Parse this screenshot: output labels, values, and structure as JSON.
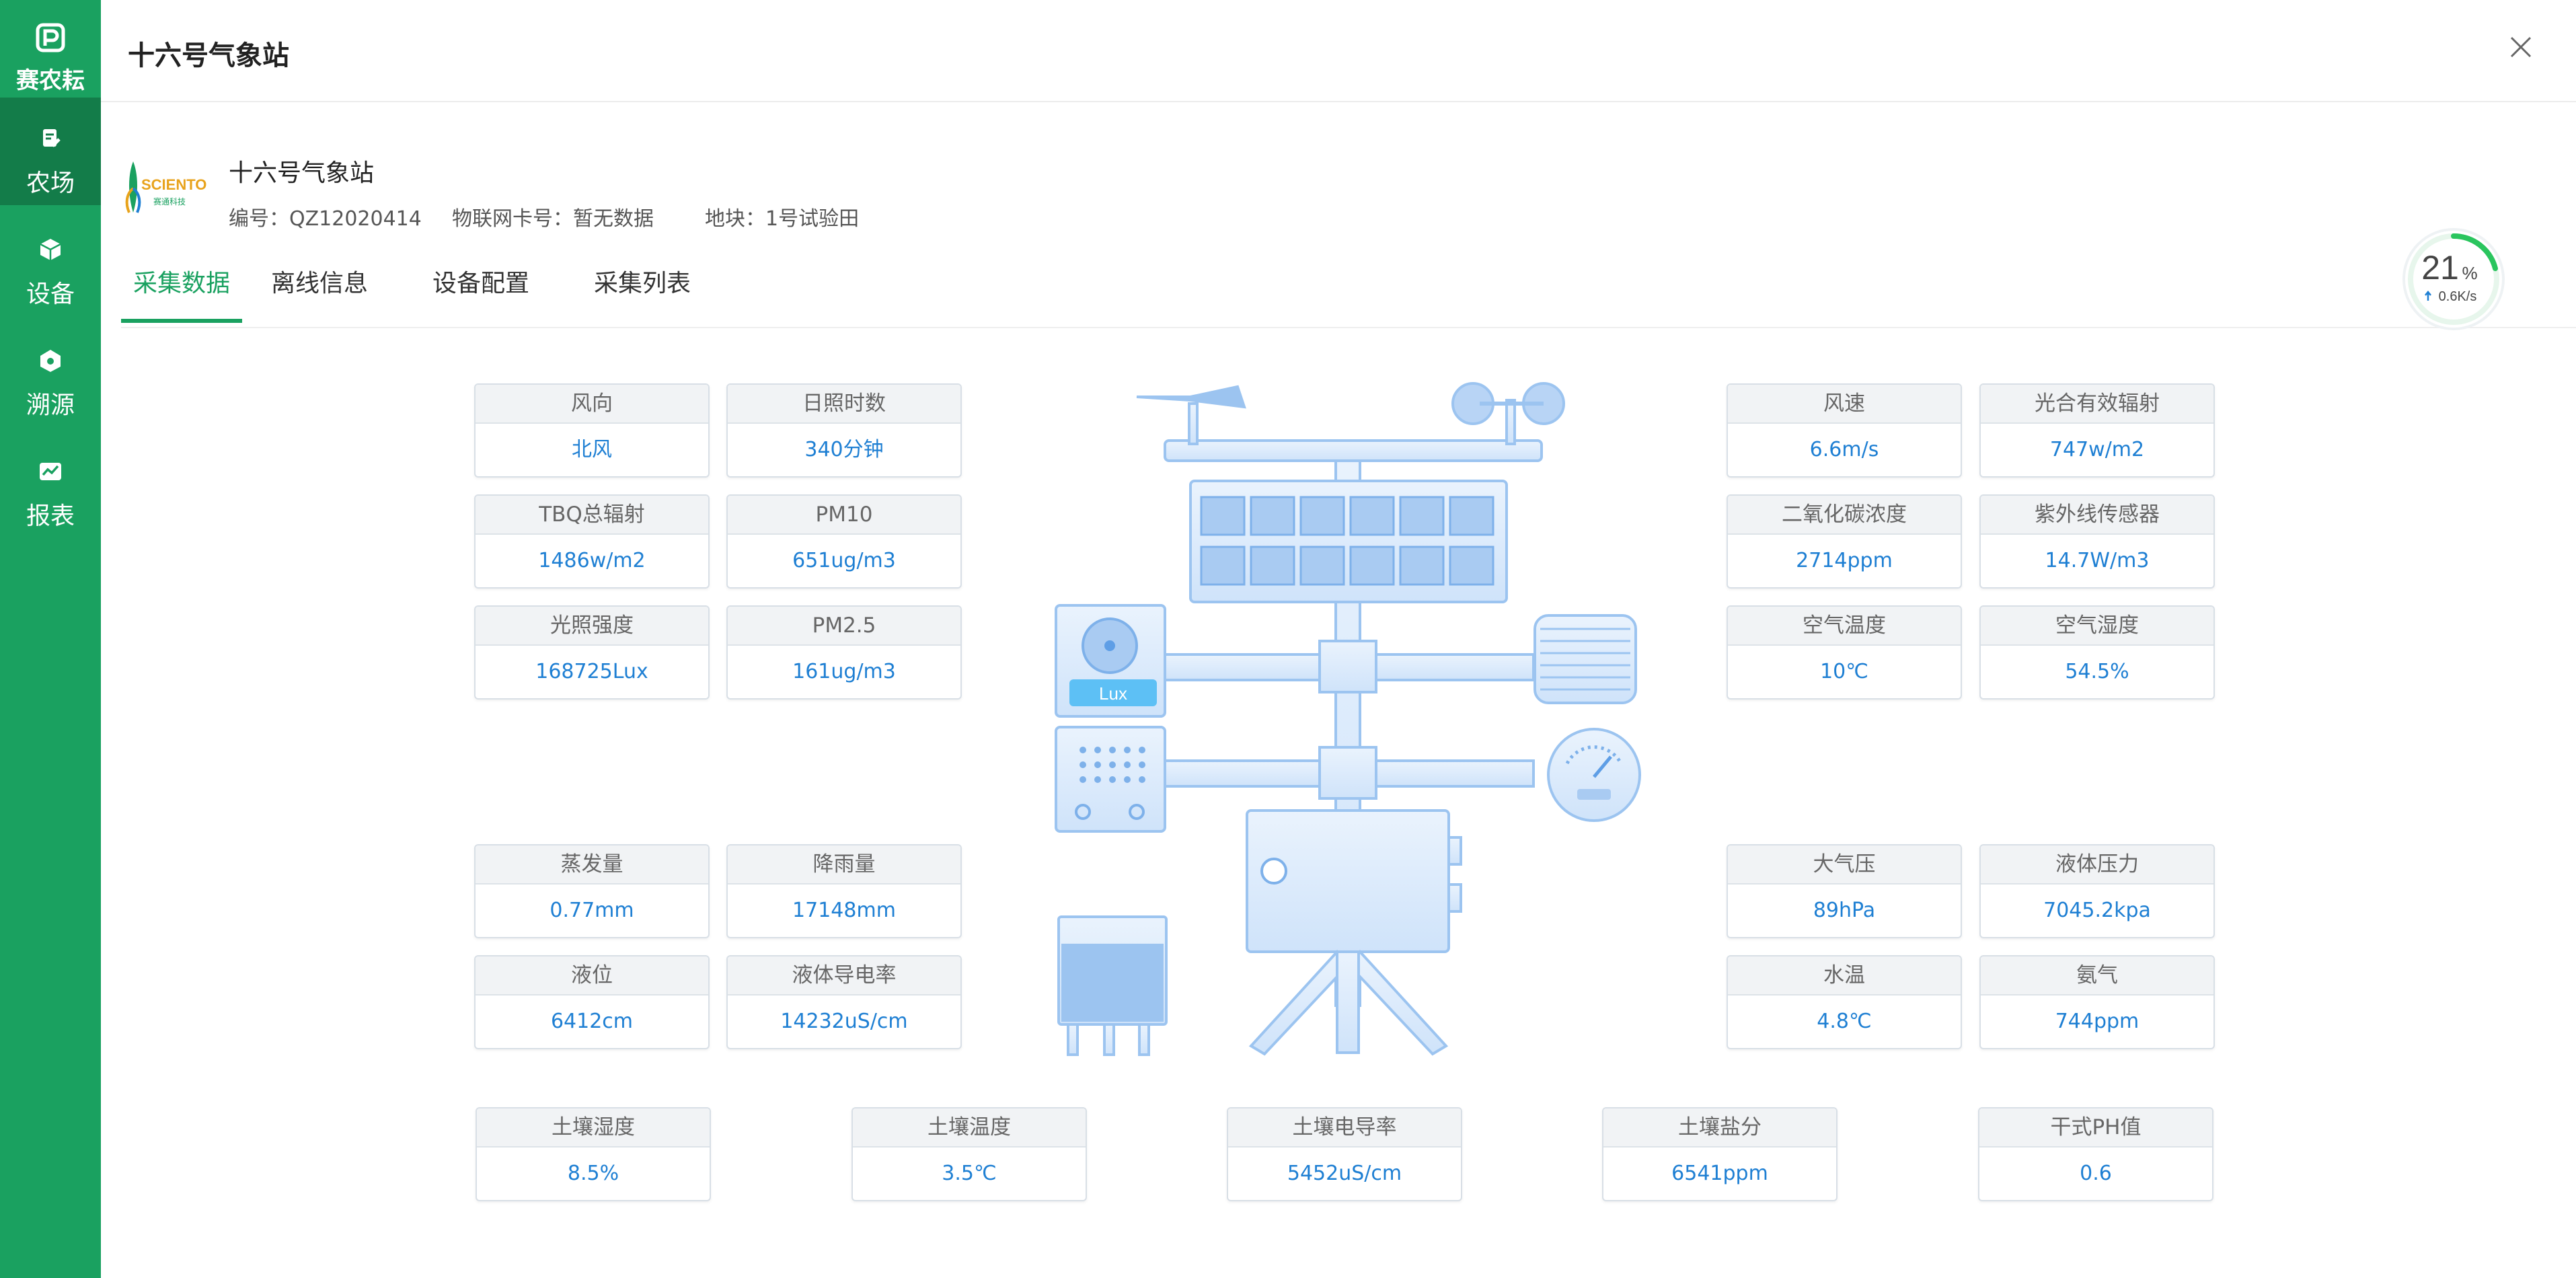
{
  "sidebar": {
    "brand": "赛农耘",
    "items": [
      {
        "label": "农场",
        "icon": "farm-icon"
      },
      {
        "label": "设备",
        "icon": "device-cube-icon"
      },
      {
        "label": "溯源",
        "icon": "trace-icon"
      },
      {
        "label": "报表",
        "icon": "report-icon"
      }
    ]
  },
  "header": {
    "title": "十六号气象站"
  },
  "device": {
    "logo_text": "SCIENTO",
    "logo_subtext": "赛通科技",
    "name": "十六号气象站",
    "code": "编号：QZ12020414",
    "iot_card": "物联网卡号：暂无数据",
    "plot": "地块：1号试验田"
  },
  "tabs": [
    "采集数据",
    "离线信息",
    "设备配置",
    "采集列表"
  ],
  "gauge": {
    "value": "21",
    "unit": "%",
    "speed": "0.6K/s"
  },
  "left_cards": [
    {
      "label": "风向",
      "value": "北风"
    },
    {
      "label": "日照时数",
      "value": "340分钟"
    },
    {
      "label": "TBQ总辐射",
      "value": "1486w/m2"
    },
    {
      "label": "PM10",
      "value": "651ug/m3"
    },
    {
      "label": "光照强度",
      "value": "168725Lux"
    },
    {
      "label": "PM2.5",
      "value": "161ug/m3"
    },
    {
      "label": "蒸发量",
      "value": "0.77mm"
    },
    {
      "label": "降雨量",
      "value": "17148mm"
    },
    {
      "label": "液位",
      "value": "6412cm"
    },
    {
      "label": "液体导电率",
      "value": "14232uS/cm"
    }
  ],
  "right_cards": [
    {
      "label": "风速",
      "value": "6.6m/s"
    },
    {
      "label": "光合有效辐射",
      "value": "747w/m2"
    },
    {
      "label": "二氧化碳浓度",
      "value": "2714ppm"
    },
    {
      "label": "紫外线传感器",
      "value": "14.7W/m3"
    },
    {
      "label": "空气温度",
      "value": "10℃"
    },
    {
      "label": "空气湿度",
      "value": "54.5%"
    },
    {
      "label": "大气压",
      "value": "89hPa"
    },
    {
      "label": "液体压力",
      "value": "7045.2kpa"
    },
    {
      "label": "水温",
      "value": "4.8℃"
    },
    {
      "label": "氨气",
      "value": "744ppm"
    }
  ],
  "bottom_cards": [
    {
      "label": "土壤湿度",
      "value": "8.5%"
    },
    {
      "label": "土壤温度",
      "value": "3.5℃"
    },
    {
      "label": "土壤电导率",
      "value": "5452uS/cm"
    },
    {
      "label": "土壤盐分",
      "value": "6541ppm"
    },
    {
      "label": "干式PH值",
      "value": "0.6"
    }
  ],
  "station_lux_label": "Lux",
  "colors": {
    "primary": "#1aa160",
    "primary_dark": "#137c49",
    "value": "#1e7fd3"
  }
}
